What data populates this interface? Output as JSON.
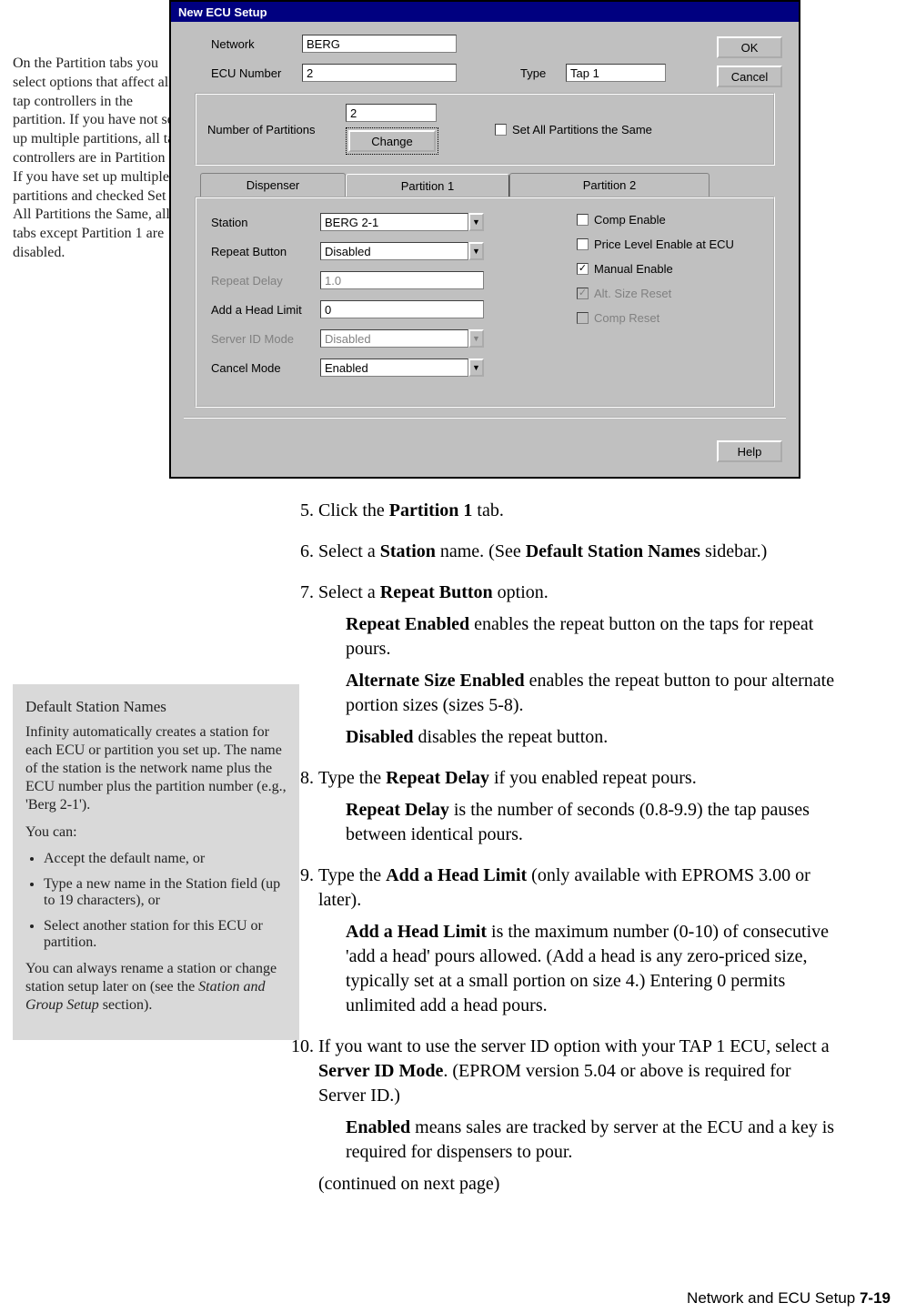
{
  "side_note_1": "On the Partition tabs you select options that affect all tap controllers in the partition. If you have not set up multiple partitions, all tap controllers are in Partition 1. If you have set up multiple partitions and checked Set All Partitions the Same, all tabs except Partition 1 are disabled.",
  "dialog": {
    "title": "New ECU Setup",
    "network_label": "Network",
    "network_value": "BERG",
    "ecu_number_label": "ECU Number",
    "ecu_number_value": "2",
    "type_label": "Type",
    "type_value": "Tap 1",
    "partitions_label": "Number of Partitions",
    "partitions_value": "2",
    "change_label": "Change",
    "set_all_label": "Set All Partitions the Same",
    "ok": "OK",
    "cancel": "Cancel",
    "help": "Help",
    "tabs": {
      "dispenser": "Dispenser",
      "p1": "Partition 1",
      "p2": "Partition 2"
    },
    "panel": {
      "station_label": "Station",
      "station_value": "BERG 2-1",
      "repeat_button_label": "Repeat Button",
      "repeat_button_value": "Disabled",
      "repeat_delay_label": "Repeat Delay",
      "repeat_delay_value": "1.0",
      "add_head_label": "Add a Head Limit",
      "add_head_value": "0",
      "server_id_label": "Server ID Mode",
      "server_id_value": "Disabled",
      "cancel_mode_label": "Cancel Mode",
      "cancel_mode_value": "Enabled",
      "comp_enable": "Comp Enable",
      "price_level": "Price Level Enable at ECU",
      "manual_enable": "Manual Enable",
      "alt_size_reset": "Alt. Size Reset",
      "comp_reset": "Comp Reset"
    }
  },
  "steps": {
    "s5": {
      "text_a": "Click the ",
      "b1": "Partition 1",
      "text_b": " tab."
    },
    "s6": {
      "text_a": "Select a ",
      "b1": "Station",
      "text_b": " name. (See ",
      "b2": "Default Station Names",
      "text_c": " sidebar.)"
    },
    "s7": {
      "text_a": "Select a ",
      "b1": "Repeat Button",
      "text_b": " option.",
      "sub1_b": "Repeat Enabled",
      "sub1_t": " enables the repeat button on the taps for repeat pours.",
      "sub2_b": "Alternate Size Enabled",
      "sub2_t": " enables the repeat button to pour alternate portion sizes (sizes 5-8).",
      "sub3_b": "Disabled",
      "sub3_t": " disables the repeat button."
    },
    "s8": {
      "text_a": "Type the ",
      "b1": "Repeat Delay",
      "text_b": " if you enabled repeat pours.",
      "sub1_b": "Repeat Delay",
      "sub1_t": " is the number of seconds (0.8-9.9) the tap pauses between identical pours."
    },
    "s9": {
      "text_a": "Type the ",
      "b1": "Add a Head Limit",
      "text_b": " (only available with EPROMS 3.00 or later).",
      "sub1_b": "Add a Head Limit",
      "sub1_t": " is the maximum number (0-10) of consecutive 'add a head' pours allowed. (Add a head is any zero-priced size, typically set at a small portion on size 4.) Entering 0 permits unlimited add a head pours."
    },
    "s10": {
      "text_a": "If you want to use the server ID option with your TAP 1 ECU, select a ",
      "b1": "Server ID Mode",
      "text_b": ". (EPROM version 5.04 or above is required for Server ID.)",
      "sub1_b": "Enabled",
      "sub1_t": " means sales are tracked by server at the ECU and a key is required for dispensers to pour.",
      "cont": "(continued on next page)"
    }
  },
  "sidebar2": {
    "title": "Default Station Names",
    "p1": "Infinity automatically creates a station for each ECU or partition you set up. The name of the station is the network name plus the ECU number plus the partition number (e.g., 'Berg 2-1').",
    "p2": "You can:",
    "b1": "Accept the default name, or",
    "b2": "Type a new name in the Station field (up to 19 characters), or",
    "b3": "Select another station for this ECU or partition.",
    "p3_a": "You can always rename a station or change station setup later on (see the ",
    "p3_em": "Station and Group Setup",
    "p3_b": " section)."
  },
  "footer": {
    "text": "Network and ECU Setup  ",
    "page": "7-19"
  }
}
